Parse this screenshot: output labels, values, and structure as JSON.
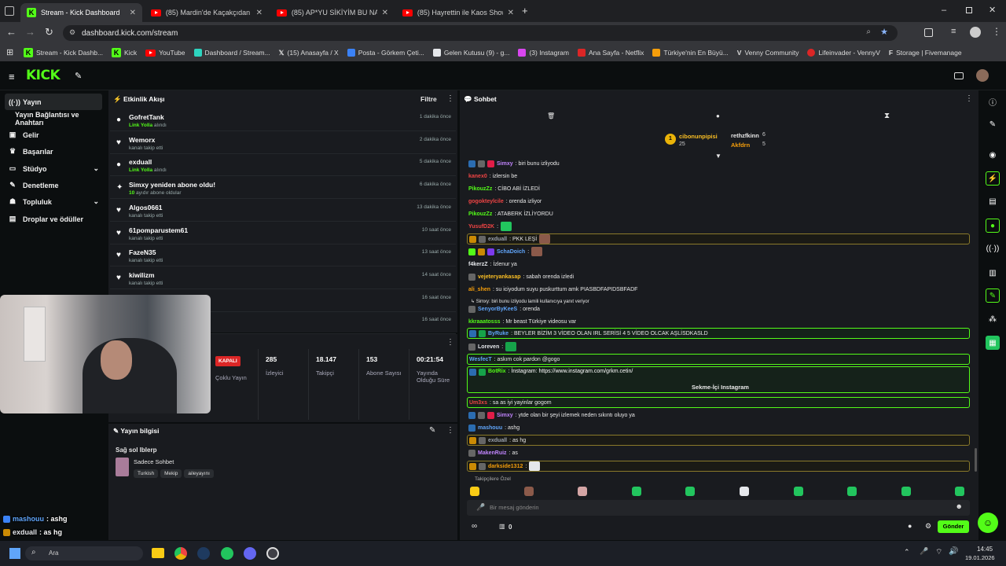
{
  "tabs": [
    {
      "label": "Stream - Kick Dashboard",
      "active": true
    },
    {
      "label": "(85) Mardin'de Kaçakçıdan 3 D"
    },
    {
      "label": "(85) AP*YU SİKİYİM BU NASIL S"
    },
    {
      "label": "(85) Hayrettin ile Kaos Show - 2"
    }
  ],
  "url": "dashboard.kick.com/stream",
  "bookmarks": [
    "Stream - Kick Dashb...",
    "Kick",
    "YouTube",
    "Dashboard / Stream...",
    "(15) Anasayfa / X",
    "Posta - Görkem Çeti...",
    "Gelen Kutusu (9) - g...",
    "(3) Instagram",
    "Ana Sayfa - Netflix",
    "Türkiye'nin En Büyü...",
    "Venny Community",
    "Lifeinvader - VennyV",
    "Storage | Fivemanage"
  ],
  "header": {
    "logo": "KICK"
  },
  "sidebar": {
    "items": [
      "Yayın",
      "Yayın Bağlantısı ve Anahtarı",
      "Gelir",
      "Başarılar",
      "Stüdyo",
      "Denetleme",
      "Topluluk",
      "Droplar ve ödüller"
    ]
  },
  "activity": {
    "title": "Etkinlik Akışı",
    "filter": "Filtre",
    "items": [
      {
        "user": "GofretTank",
        "sub1": "Link Yolla",
        "sub2": " alındı",
        "time": "1 dakika önce"
      },
      {
        "user": "Wemorx",
        "sub1": "",
        "sub2": "kanalı takip etti",
        "time": "2 dakika önce"
      },
      {
        "user": "exduall",
        "sub1": "Link Yolla",
        "sub2": " alındı",
        "time": "5 dakika önce"
      },
      {
        "user": "Simxy yeniden abone oldu!",
        "sub1": "10",
        "sub2": " ayıdır abone oldular",
        "time": "6 dakika önce"
      },
      {
        "user": "Algos0661",
        "sub1": "",
        "sub2": "kanalı takip etti",
        "time": "13 dakika önce"
      },
      {
        "user": "61pomparustem61",
        "sub1": "",
        "sub2": "kanalı takip etti",
        "time": "10 saat önce"
      },
      {
        "user": "FazeN35",
        "sub1": "",
        "sub2": "kanalı takip etti",
        "time": "13 saat önce"
      },
      {
        "user": "kiwilizm",
        "sub1": "",
        "sub2": "kanalı takip etti",
        "time": "14 saat önce"
      },
      {
        "user": "",
        "sub1": "",
        "sub2": "",
        "time": "16 saat önce"
      },
      {
        "user": "",
        "sub1": "",
        "sub2": "",
        "time": "16 saat önce"
      }
    ]
  },
  "stats": {
    "status": "KAPALI",
    "multi": "Çoklu Yayın",
    "viewers": "285",
    "viewers_l": "İzleyici",
    "followers": "18.147",
    "followers_l": "Takipçi",
    "subs": "153",
    "subs_l": "Abone Sayısı",
    "uptime": "00:21:54",
    "uptime_l": "Yayında Olduğu Süre"
  },
  "streaminfo": {
    "title": "Yayın bilgisi",
    "stream_title": "Sağ sol lblerp",
    "category": "Sadece Sohbet",
    "tags": [
      "Turkish",
      "Mekip",
      "aileyayını"
    ]
  },
  "chat": {
    "title": "Sohbet",
    "pinned": {
      "u1": "cibonunpipisi",
      "n1": "25",
      "u2": "rethzfkinn",
      "n2": "6",
      "u3": "Akfdrn",
      "n3": "5"
    },
    "messages": [
      {
        "user": "Simxy",
        "text": ": biri bunu izliyodu",
        "color": "#c084fc",
        "badges": [
          "#2b6cb0",
          "#666",
          "#e11d48"
        ]
      },
      {
        "user": "kanex0",
        "text": ": izlersin be",
        "color": "#ef4444"
      },
      {
        "user": "PikouzZz",
        "text": ": CİBO ABİ İZLEDİ",
        "color": "#53fc18"
      },
      {
        "user": "gogokteylcile",
        "text": ": orenda izliyor",
        "color": "#ef4444"
      },
      {
        "user": "PikouzZz",
        "text": ": ATABERK İZLİYORDU",
        "color": "#53fc18"
      },
      {
        "user": "YusufD2K",
        "text": ":",
        "color": "#ef4444"
      },
      {
        "user": "exduall",
        "text": ": PKK LEŞİ",
        "color": "#9ca3af",
        "badges": [
          "#ca8a04",
          "#666"
        ]
      },
      {
        "user": "SchaDoich",
        "text": ":",
        "color": "#60a5fa",
        "badges": [
          "#53fc18",
          "#ca8a04",
          "#7c3aed"
        ]
      },
      {
        "user": "f4kerzZ",
        "text": ": İzlenur ya",
        "color": "#e5e7eb"
      },
      {
        "user": "vejeteryankasap",
        "text": ": sabah orenda izledi",
        "color": "#fbbf24",
        "badges": [
          "#666"
        ]
      },
      {
        "user": "ali_shen",
        "text": ": su iciyodum suyu puskurttum amk PIASBDFAPIDSBFADF",
        "color": "#f59e0b"
      },
      {
        "user": "",
        "text": "↳ Simxy: biri bunu izliyodu lamili kullanıcıya yanıt veriyor",
        "color": "#888"
      },
      {
        "user": "SenyorByKeeS",
        "text": ": orenda",
        "color": "#60a5fa",
        "badges": [
          "#666"
        ]
      },
      {
        "user": "kkraaatosss",
        "text": ": Mr beast Türkiye videosu var",
        "color": "#53fc18"
      },
      {
        "user": "ByRuke",
        "text": ": BEYLER BİZİM 3 VİDEO OLAN IRL SERİSİ 4 5 VİDEO OLCAK AŞLİSDKASLD",
        "color": "#60a5fa",
        "badges": [
          "#2b6cb0",
          "#16a34a"
        ]
      },
      {
        "user": "Loreven",
        "text": ":",
        "color": "#e5e7eb",
        "badges": [
          "#666"
        ]
      },
      {
        "user": "WesfecT",
        "text": ": askım cok pardon @gogo",
        "color": "#60a5fa"
      },
      {
        "user": "BotRix",
        "text": ": İnstagram: https://www.instagram.com/grkm.cetin/",
        "color": "#53fc18",
        "badges": [
          "#2b6cb0",
          "#16a34a"
        ]
      },
      {
        "user": "",
        "text": "Sekme-İçi Instagram",
        "color": "#fff"
      },
      {
        "user": "Um3xs",
        "text": ": sa as iyi yayinlar gogom",
        "color": "#ef4444"
      },
      {
        "user": "Simxy",
        "text": ": ytde olan bir şeyi izlemek neden sıkıntı oluyo ya",
        "color": "#c084fc",
        "badges": [
          "#2b6cb0",
          "#666",
          "#e11d48"
        ]
      },
      {
        "user": "mashouu",
        "text": ": ashg",
        "color": "#60a5fa",
        "badges": [
          "#2b6cb0"
        ]
      },
      {
        "user": "exduall",
        "text": ": as hg",
        "color": "#9ca3af",
        "badges": [
          "#ca8a04",
          "#666"
        ]
      },
      {
        "user": "MakenRuiz",
        "text": ": as",
        "color": "#c084fc",
        "badges": [
          "#666"
        ]
      },
      {
        "user": "darkside1312",
        "text": ":",
        "color": "#f59e0b",
        "badges": [
          "#ca8a04",
          "#666"
        ]
      }
    ],
    "emote_label": "Takipçilere Özel",
    "input_placeholder": "Bir mesaj gönderin",
    "count": "0",
    "send": "Gönder"
  },
  "overlay": [
    {
      "user": "mashouu",
      "text": ": ashg",
      "color": "#60a5fa"
    },
    {
      "user": "exduall",
      "text": ": as hg",
      "color": "#e5e7eb"
    },
    {
      "user": "MakenRuiz",
      "text": ": as",
      "color": "#c084fc"
    },
    {
      "user": "darkside1312",
      "text": ":",
      "color": "#f59e0b"
    }
  ],
  "taskbar": {
    "search": "Ara",
    "time": "14:45",
    "date": "19.01.2026"
  }
}
